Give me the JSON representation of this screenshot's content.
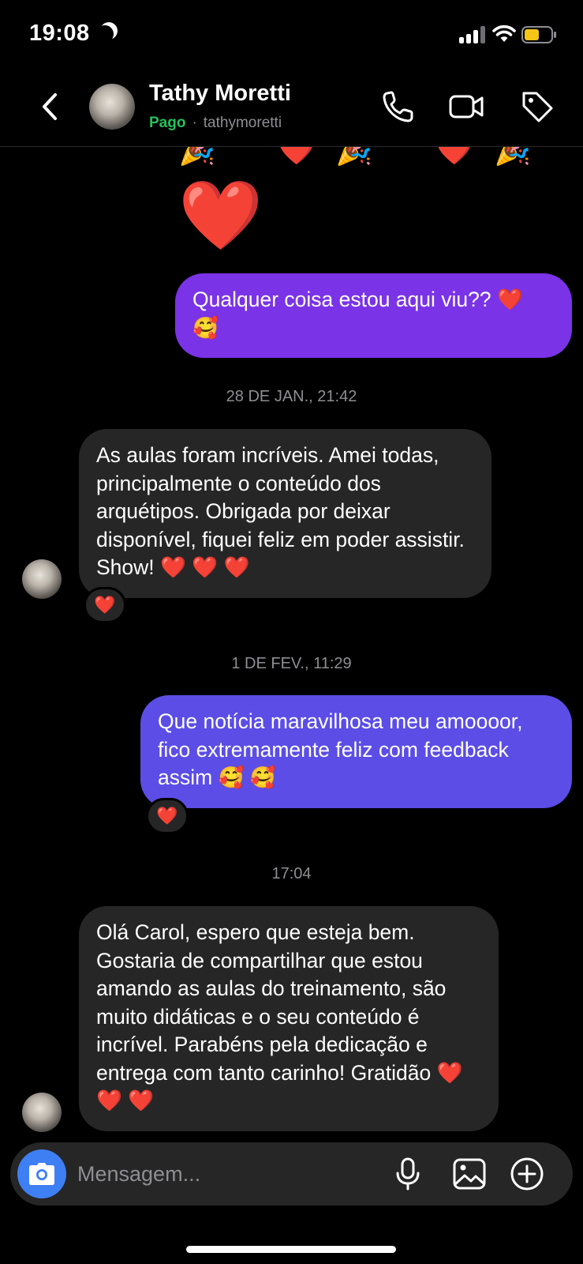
{
  "status_bar": {
    "time": "19:08",
    "battery_color": "#f5c518"
  },
  "header": {
    "contact_name": "Tathy Moretti",
    "paid_label": "Pago",
    "separator": "·",
    "username": "tathymoretti"
  },
  "messages": [
    {
      "direction": "outgoing",
      "text": "Qualquer coisa estou aqui viu?? ❤️ 🥰",
      "color": "#7a33e6"
    },
    {
      "type": "timestamp",
      "text": "28 DE JAN., 21:42"
    },
    {
      "direction": "incoming",
      "text": "As aulas foram incríveis. Amei todas, principalmente o conteúdo dos arquétipos. Obrigada por deixar disponível, fiquei feliz em poder assistir. Show! ❤️ ❤️ ❤️",
      "reaction": "❤️"
    },
    {
      "type": "timestamp",
      "text": "1 DE FEV., 11:29"
    },
    {
      "direction": "outgoing",
      "text": "Que notícia maravilhosa meu amoooor, fico extremamente feliz com feedback assim 🥰 🥰",
      "reaction": "❤️",
      "color": "#5b4de6"
    },
    {
      "type": "timestamp",
      "text": "17:04"
    },
    {
      "direction": "incoming",
      "text": "Olá Carol, espero que esteja bem. Gostaria de compartilhar que estou amando as aulas do treinamento, são muito didáticas e o seu conteúdo é incrível. Parabéns pela dedicação e entrega com tanto carinho! Gratidão ❤️ ❤️ ❤️"
    }
  ],
  "emoji_row": [
    "🎉",
    "❤️",
    "🎉",
    "❤️",
    "🎉"
  ],
  "big_emoji": "❤️",
  "composer": {
    "placeholder": "Mensagem..."
  },
  "colors": {
    "background": "#000000",
    "incoming_bubble": "#262626",
    "paid_green": "#25c15a",
    "camera_blue": "#3f7ff4"
  }
}
